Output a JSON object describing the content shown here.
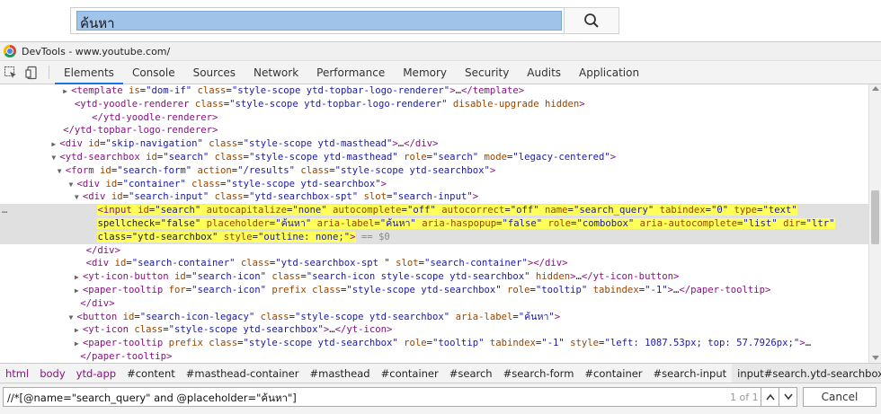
{
  "page": {
    "search_text": "ค้นหา",
    "search_button_icon": "search-icon"
  },
  "devtools": {
    "title": "DevTools - www.youtube.com/",
    "tabs": [
      "Elements",
      "Console",
      "Sources",
      "Network",
      "Performance",
      "Memory",
      "Security",
      "Audits",
      "Application"
    ],
    "active_tab": "Elements",
    "accent_color": "#1a73e8",
    "highlight_color": "#ffff5a",
    "dom_lines": [
      {
        "indent": 12,
        "tri": "▶",
        "text": "<template is=\"dom-if\" class=\"style-scope ytd-topbar-logo-renderer\">…</template>"
      },
      {
        "indent": 13,
        "tri": "",
        "text": "<ytd-yoodle-renderer class=\"style-scope ytd-topbar-logo-renderer\" disable-upgrade hidden>"
      },
      {
        "indent": 16,
        "tri": "",
        "text": "</ytd-yoodle-renderer>"
      },
      {
        "indent": 11,
        "tri": "",
        "text": "</ytd-topbar-logo-renderer>"
      },
      {
        "indent": 10,
        "tri": "▶",
        "text": "<div id=\"skip-navigation\" class=\"style-scope ytd-masthead\">…</div>"
      },
      {
        "indent": 10,
        "tri": "▼",
        "text": "<ytd-searchbox id=\"search\" class=\"style-scope ytd-masthead\" role=\"search\" mode=\"legacy-centered\">"
      },
      {
        "indent": 11,
        "tri": "▼",
        "text": "<form id=\"search-form\" action=\"/results\" class=\"style-scope ytd-searchbox\">"
      },
      {
        "indent": 13,
        "tri": "▼",
        "text": "<div id=\"container\" class=\"style-scope ytd-searchbox\">"
      },
      {
        "indent": 14,
        "tri": "▼",
        "text": "<div id=\"search-input\" class=\"ytd-searchbox-spt\" slot=\"search-input\">"
      }
    ],
    "selected_lines": [
      "<input id=\"search\" autocapitalize=\"none\" autocomplete=\"off\" autocorrect=\"off\" name=\"search_query\" tabindex=\"0\" type=\"text\"",
      "spellcheck=\"false\" placeholder=\"ค้นหา\" aria-label=\"ค้นหา\" aria-haspopup=\"false\" role=\"combobox\" aria-autocomplete=\"list\" dir=\"ltr\"",
      "class=\"ytd-searchbox\" style=\"outline: none;\">"
    ],
    "selected_marker": "== $0",
    "row_dots": "…",
    "dom_lines_after": [
      {
        "indent": 15,
        "tri": "",
        "text": "</div>"
      },
      {
        "indent": 15,
        "tri": "",
        "text": "<div id=\"search-container\" class=\"ytd-searchbox-spt \" slot=\"search-container\"></div>"
      },
      {
        "indent": 14,
        "tri": "▶",
        "text": "<yt-icon-button id=\"search-icon\" class=\"search-icon style-scope ytd-searchbox\" hidden>…</yt-icon-button>"
      },
      {
        "indent": 14,
        "tri": "▶",
        "text": "<paper-tooltip for=\"search-icon\" prefix class=\"style-scope ytd-searchbox\" role=\"tooltip\" tabindex=\"-1\">…</paper-tooltip>"
      },
      {
        "indent": 14,
        "tri": "",
        "text": "</div>"
      },
      {
        "indent": 13,
        "tri": "▼",
        "text": "<button id=\"search-icon-legacy\" class=\"style-scope ytd-searchbox\" aria-label=\"ค้นหา\">"
      },
      {
        "indent": 14,
        "tri": "▶",
        "text": "<yt-icon class=\"style-scope ytd-searchbox\">…</yt-icon>"
      },
      {
        "indent": 14,
        "tri": "▶",
        "text": "<paper-tooltip prefix class=\"style-scope ytd-searchbox\" role=\"tooltip\" tabindex=\"-1\" style=\"left: 1087.53px; top: 57.7926px;\">…"
      },
      {
        "indent": 14,
        "tri": "",
        "text": "</paper-tooltip>"
      }
    ],
    "breadcrumb": [
      {
        "label": "html",
        "type": "tag"
      },
      {
        "label": "body",
        "type": "tag"
      },
      {
        "label": "ytd-app",
        "type": "tag"
      },
      {
        "label": "#content",
        "type": "id"
      },
      {
        "label": "#masthead-container",
        "type": "id"
      },
      {
        "label": "#masthead",
        "type": "id"
      },
      {
        "label": "#container",
        "type": "id"
      },
      {
        "label": "#search",
        "type": "id"
      },
      {
        "label": "#search-form",
        "type": "id"
      },
      {
        "label": "#container",
        "type": "id"
      },
      {
        "label": "#search-input",
        "type": "id"
      },
      {
        "label": "input#search.ytd-searchbox",
        "type": "id"
      }
    ],
    "search": {
      "query": "//*[@name=\"search_query\" and @placeholder=\"ค้นหา\"]",
      "match_count": "1 of 1",
      "cancel_label": "Cancel"
    }
  }
}
